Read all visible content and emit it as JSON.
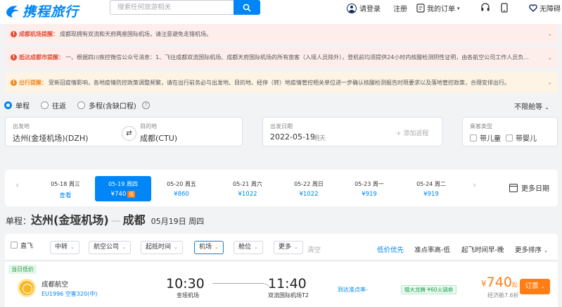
{
  "header": {
    "logo_text": "携程旅行",
    "search_placeholder": "搜索任何旅游相关",
    "login": "请登录",
    "register": "注册",
    "my_orders": "我的订单",
    "accessibility": "无障碍"
  },
  "notices": [
    {
      "title": "成都机场提醒：",
      "text": "成都现拥有双流和天府两座国际机场，请注意避免走错机场。"
    },
    {
      "title": "抵达成都市提醒：",
      "text": "一、根据四川疾控微信公众号消息：1、飞往成都双流国际机场、成都天府国际机场的所有旅客（入境人员除外），登机前均须提供24小时内核酸检测阴性证明，由各航空公司工作人员负..."
    },
    {
      "title": "出行提醒：",
      "text": "受新冠疫情影响，各地疫情防控政策调整频繁，请在出行前务必与出发地、目的地、经停（转）地疫情管控相关单位进一步确认核酸检测报告时限要求以及落地管控政策，合理安排出行。"
    }
  ],
  "trip_types": [
    "单程",
    "往返",
    "多程(含缺口程)"
  ],
  "cabin_class": "不限舱等",
  "form": {
    "from_label": "出发地",
    "from_value": "达州(金垭机场)(DZH)",
    "to_label": "目的地",
    "to_value": "成都(CTU)",
    "date_label": "出发日期",
    "date_value": "2022-05-19",
    "date_day": "明天",
    "add_return": "+ 添加返程",
    "pax_label": "乘客类型",
    "child": "带儿童",
    "infant": "带婴儿"
  },
  "dates": [
    {
      "date": "05-18",
      "weekday": "周三",
      "price": "查看"
    },
    {
      "date": "05-19",
      "weekday": "周四",
      "price": "¥740",
      "badge": "低"
    },
    {
      "date": "05-20",
      "weekday": "周五",
      "price": "¥860"
    },
    {
      "date": "05-21",
      "weekday": "周六",
      "price": "¥1022"
    },
    {
      "date": "05-22",
      "weekday": "周日",
      "price": "¥1022"
    },
    {
      "date": "05-23",
      "weekday": "周一",
      "price": "¥919"
    },
    {
      "date": "05-24",
      "weekday": "周二",
      "price": "¥919"
    }
  ],
  "more_dates": "更多日期",
  "route": {
    "kind": "单程：",
    "from": "达州(金垭机场)",
    "to": "成都",
    "date": "05月19日 周四"
  },
  "filters": {
    "direct": "直飞",
    "buttons": [
      "中转",
      "航空公司",
      "起抵时间",
      "机场",
      "舱位",
      "更多"
    ],
    "clear": "清空",
    "sorts": [
      "低价优先",
      "准点率高-低",
      "起飞时间早-晚",
      "更多排序"
    ]
  },
  "flight": {
    "tag": "当日低价",
    "airline": "成都航空",
    "flight_no": "EU1996 空客320(中)",
    "dep_time": "10:30",
    "dep_airport": "金垭机场",
    "arr_time": "11:40",
    "arr_airport": "双流国际机场T2",
    "ontime": "到达准点率-",
    "promo": "赠大龙腾 ¥60火锅券",
    "price_symbol": "¥",
    "price": "740",
    "price_suffix": "起",
    "discount": "经济舱7.6折",
    "book": "订票"
  },
  "colors": {
    "brand": "#0086f6",
    "price": "#ff7d13",
    "alert": "#e34c35",
    "warn": "#f08a24"
  }
}
